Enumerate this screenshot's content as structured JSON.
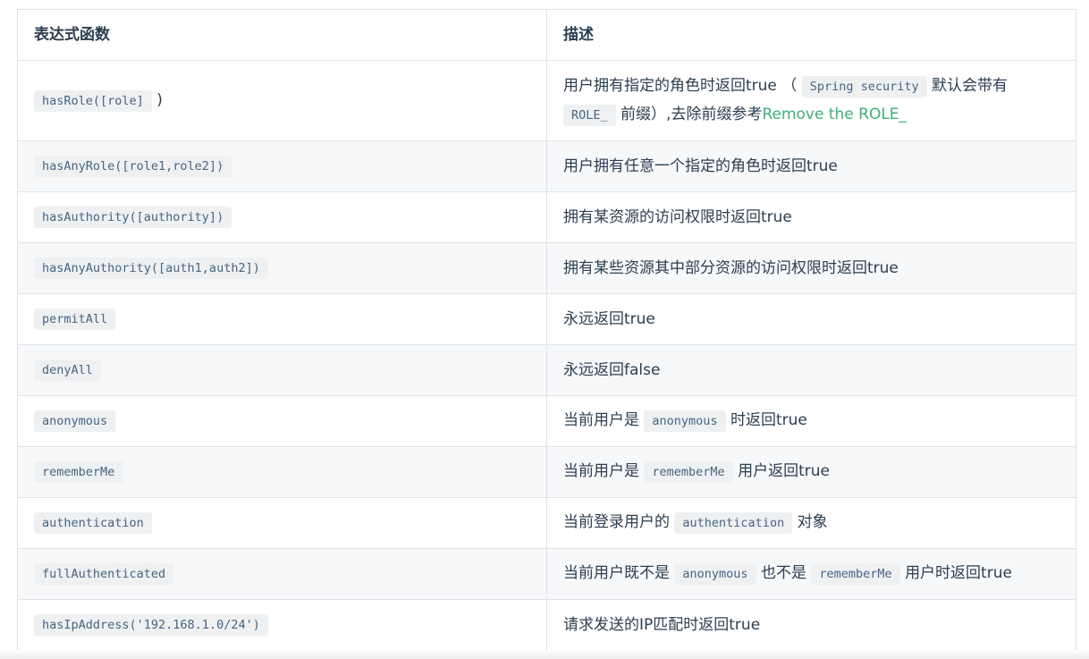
{
  "table": {
    "headers": [
      "表达式函数",
      "描述"
    ],
    "rows": [
      {
        "code": "hasRole([role]",
        "code_suffix": ")",
        "desc_parts": {
          "t1": "用户拥有指定的角色时返回true （",
          "c1": "Spring security",
          "t2": "默认会带有",
          "c2": "ROLE_",
          "t3": "前缀）,去除前缀参考",
          "link": "Remove the ROLE_"
        }
      },
      {
        "code": "hasAnyRole([role1,role2])",
        "desc": "用户拥有任意一个指定的角色时返回true"
      },
      {
        "code": "hasAuthority([authority])",
        "desc": "拥有某资源的访问权限时返回true"
      },
      {
        "code": "hasAnyAuthority([auth1,auth2])",
        "desc": "拥有某些资源其中部分资源的访问权限时返回true"
      },
      {
        "code": "permitAll",
        "desc": "永远返回true"
      },
      {
        "code": "denyAll",
        "desc": "永远返回false"
      },
      {
        "code": "anonymous",
        "desc_pre": "当前用户是",
        "desc_code": "anonymous",
        "desc_post": "时返回true"
      },
      {
        "code": "rememberMe",
        "desc_pre": "当前用户是",
        "desc_code": "rememberMe",
        "desc_post": "用户返回true"
      },
      {
        "code": "authentication",
        "desc_pre": "当前登录用户的",
        "desc_code": "authentication",
        "desc_post": "对象"
      },
      {
        "code": "fullAuthenticated",
        "desc_pre": "当前用户既不是",
        "desc_code": "anonymous",
        "desc_mid": "也不是",
        "desc_code2": "rememberMe",
        "desc_post": "用户时返回true"
      },
      {
        "code": "hasIpAddress('192.168.1.0/24')",
        "desc": "请求发送的IP匹配时返回true"
      }
    ]
  },
  "colors": {
    "link": "#3eaf7c",
    "border": "#dfe2e5",
    "row_alt": "#f6f8fa",
    "code_bg": "#eef0f2",
    "code_text": "#476582",
    "text": "#2c3e50"
  }
}
